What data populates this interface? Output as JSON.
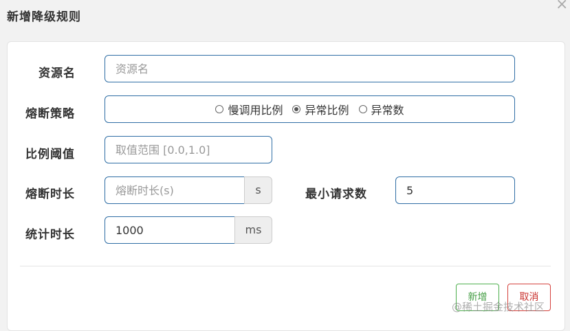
{
  "dialog": {
    "title": "新增降级规则",
    "close_icon": "×"
  },
  "form": {
    "resource_name": {
      "label": "资源名",
      "placeholder": "资源名",
      "value": ""
    },
    "strategy": {
      "label": "熔断策略",
      "options": [
        "慢调用比例",
        "异常比例",
        "异常数"
      ],
      "selected": "异常比例"
    },
    "ratio_threshold": {
      "label": "比例阈值",
      "placeholder": "取值范围 [0.0,1.0]",
      "value": ""
    },
    "break_duration": {
      "label": "熔断时长",
      "placeholder": "熔断时长(s)",
      "value": "",
      "unit": "s"
    },
    "min_requests": {
      "label": "最小请求数",
      "value": "5"
    },
    "stat_duration": {
      "label": "统计时长",
      "value": "1000",
      "unit": "ms"
    }
  },
  "buttons": {
    "add": "新增",
    "cancel": "取消"
  },
  "watermark": "@稀土掘金技术社区"
}
